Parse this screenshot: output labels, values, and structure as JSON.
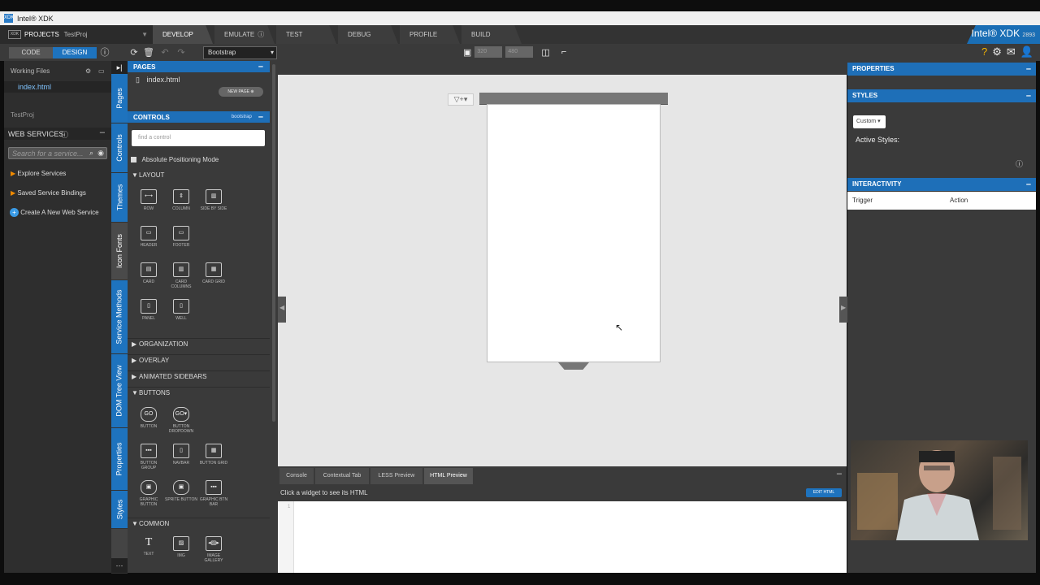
{
  "window": {
    "title": "Intel® XDK"
  },
  "nav": {
    "projects_label": "PROJECTS",
    "project_name": "TestProj",
    "tabs": [
      "DEVELOP",
      "EMULATE",
      "TEST",
      "DEBUG",
      "PROFILE",
      "BUILD"
    ],
    "active_tab": "DEVELOP",
    "brand": "Intel® XDK",
    "build_number": "2893"
  },
  "toolbar": {
    "code_label": "CODE",
    "design_label": "DESIGN",
    "framework": "Bootstrap",
    "width": "320",
    "height": "480"
  },
  "left": {
    "working_files": "Working Files",
    "file": "index.html",
    "project": "TestProj",
    "web_services": "WEB SERVICES",
    "search_placeholder": "Search for a service...",
    "explore": "Explore Services",
    "saved": "Saved Service Bindings",
    "create": "Create A New Web Service"
  },
  "vtabs": [
    "Pages",
    "Controls",
    "Themes",
    "Icon Fonts",
    "Service Methods",
    "DOM Tree View",
    "Properties",
    "Styles"
  ],
  "controls": {
    "pages_header": "PAGES",
    "page_file": "index.html",
    "new_page": "NEW PAGE",
    "controls_header": "CONTROLS",
    "framework_tag": "bootstrap",
    "find_placeholder": "find a control",
    "absolute_mode": "Absolute Positioning Mode",
    "layout": "LAYOUT",
    "layout_items": [
      "ROW",
      "COLUMN",
      "SIDE BY SIDE",
      "HEADER",
      "FOOTER",
      "CARD",
      "CARD COLUMNS",
      "CARD GRID",
      "PANEL",
      "WELL"
    ],
    "organization": "ORGANIZATION",
    "overlay": "OVERLAY",
    "animated_sidebars": "ANIMATED SIDEBARS",
    "buttons": "BUTTONS",
    "button_items": [
      "BUTTON",
      "BUTTON DROPDOWN",
      "BUTTON GROUP",
      "NAVBAR",
      "BUTTON GRID",
      "GRAPHIC BUTTON",
      "SPRITE BUTTON",
      "GRAPHIC BTN BAR"
    ],
    "common": "COMMON",
    "common_items": [
      "TEXT",
      "IMG",
      "IMAGE GALLERY"
    ]
  },
  "bottom": {
    "tabs": [
      "Console",
      "Contextual Tab",
      "LESS Preview",
      "HTML Preview"
    ],
    "active_tab": "HTML Preview",
    "hint": "Click a widget to see its HTML",
    "edit_html": "EDIT HTML",
    "line_number": "1"
  },
  "right": {
    "properties": "PROPERTIES",
    "styles": "STYLES",
    "style_select": "Custom",
    "active_styles": "Active Styles:",
    "interactivity": "INTERACTIVITY",
    "trigger": "Trigger",
    "action": "Action"
  },
  "colors": {
    "accent": "#1e73be",
    "background": "#3a3a3a"
  }
}
